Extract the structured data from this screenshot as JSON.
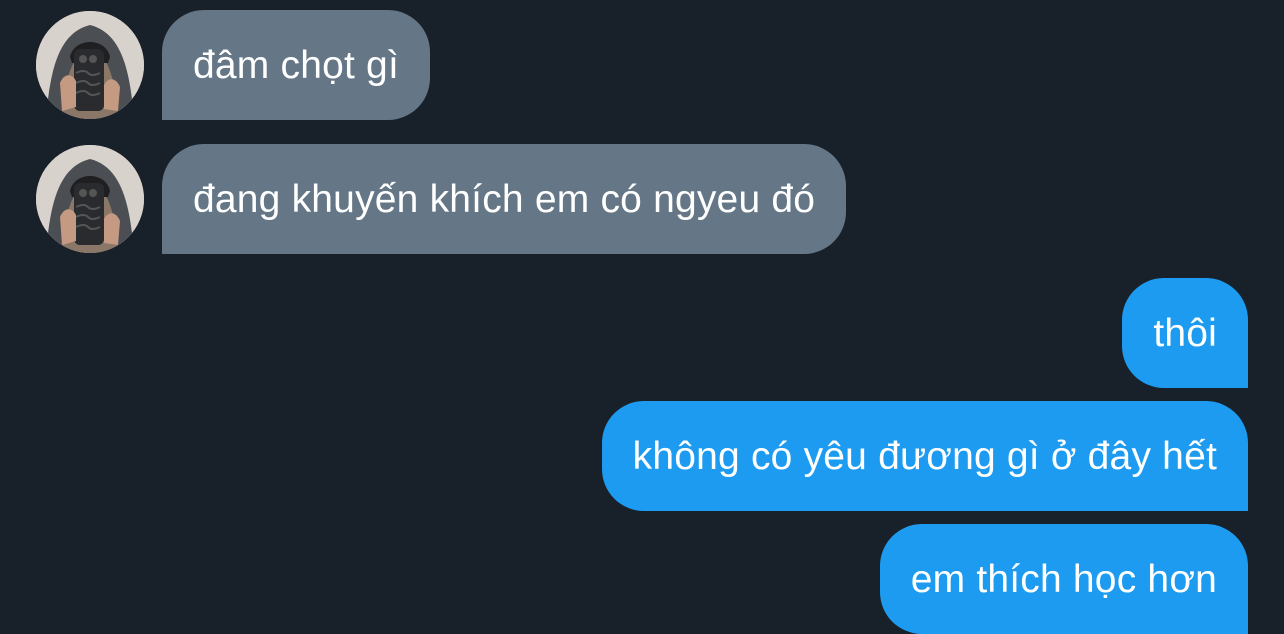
{
  "conversation": {
    "messages": [
      {
        "direction": "incoming",
        "text": "đâm chọt gì",
        "avatar": "user-avatar"
      },
      {
        "direction": "incoming",
        "text": "đang khuyến khích em có ngyeu đó",
        "avatar": "user-avatar"
      },
      {
        "direction": "outgoing",
        "text": "thôi"
      },
      {
        "direction": "outgoing",
        "text": "không có yêu đương gì ở đây hết"
      },
      {
        "direction": "outgoing",
        "text": "em thích học hơn"
      }
    ]
  },
  "colors": {
    "background": "#18202a",
    "incoming_bubble": "#657786",
    "outgoing_bubble": "#1d9bf0",
    "text": "#ffffff"
  }
}
